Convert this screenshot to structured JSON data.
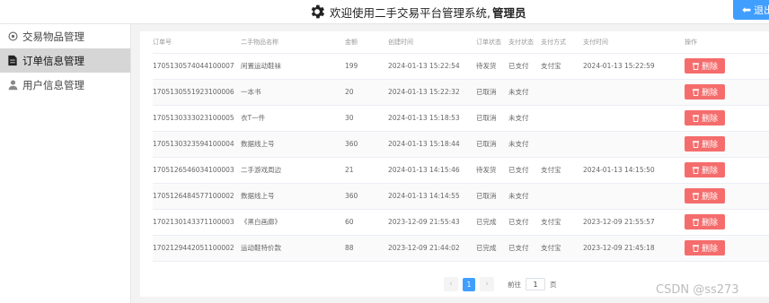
{
  "header": {
    "title_prefix": "欢迎使用二手交易平台管理系统,",
    "role": "管理员",
    "logout_label": "退出"
  },
  "sidebar": {
    "items": [
      {
        "label": "交易物品管理",
        "icon": "box-icon"
      },
      {
        "label": "订单信息管理",
        "icon": "document-icon"
      },
      {
        "label": "用户信息管理",
        "icon": "user-icon"
      }
    ]
  },
  "table": {
    "columns": [
      "订单号",
      "二手物品名称",
      "金额",
      "创建时间",
      "订单状态",
      "支付状态",
      "支付方式",
      "支付时间",
      "操作"
    ],
    "delete_label": "删除",
    "rows": [
      {
        "order_no": "1705130574044100007",
        "item": "闲置运动鞋袜",
        "amount": "199",
        "created": "2024-01-13 15:22:54",
        "status": "待发货",
        "pay_status": "已支付",
        "pay_method": "支付宝",
        "pay_time": "2024-01-13 15:22:59"
      },
      {
        "order_no": "1705130551923100006",
        "item": "一本书",
        "amount": "20",
        "created": "2024-01-13 15:22:32",
        "status": "已取消",
        "pay_status": "未支付",
        "pay_method": "",
        "pay_time": ""
      },
      {
        "order_no": "1705130333023100005",
        "item": "衣T一件",
        "amount": "30",
        "created": "2024-01-13 15:18:53",
        "status": "已取消",
        "pay_status": "未支付",
        "pay_method": "",
        "pay_time": ""
      },
      {
        "order_no": "1705130323594100004",
        "item": "数据线上号",
        "amount": "360",
        "created": "2024-01-13 15:18:44",
        "status": "已取消",
        "pay_status": "未支付",
        "pay_method": "",
        "pay_time": ""
      },
      {
        "order_no": "1705126546034100003",
        "item": "二手游戏周边",
        "amount": "21",
        "created": "2024-01-13 14:15:46",
        "status": "待发货",
        "pay_status": "已支付",
        "pay_method": "支付宝",
        "pay_time": "2024-01-13 14:15:50"
      },
      {
        "order_no": "1705126484577100002",
        "item": "数据线上号",
        "amount": "360",
        "created": "2024-01-13 14:14:55",
        "status": "已取消",
        "pay_status": "未支付",
        "pay_method": "",
        "pay_time": ""
      },
      {
        "order_no": "1702130143371100003",
        "item": "《黑白画廊》",
        "amount": "60",
        "created": "2023-12-09 21:55:43",
        "status": "已完成",
        "pay_status": "已支付",
        "pay_method": "支付宝",
        "pay_time": "2023-12-09 21:55:57"
      },
      {
        "order_no": "1702129442051100002",
        "item": "运动鞋特价款",
        "amount": "88",
        "created": "2023-12-09 21:44:02",
        "status": "已完成",
        "pay_status": "已支付",
        "pay_method": "支付宝",
        "pay_time": "2023-12-09 21:45:18"
      }
    ]
  },
  "pagination": {
    "prev": "‹",
    "current": "1",
    "next": "›",
    "goto_prefix": "前往",
    "goto_value": "1",
    "goto_suffix": "页"
  },
  "watermark": "CSDN @ss273",
  "colors": {
    "accent": "#409eff",
    "danger": "#f56c6c",
    "active_menu": "#d6d6d6"
  }
}
